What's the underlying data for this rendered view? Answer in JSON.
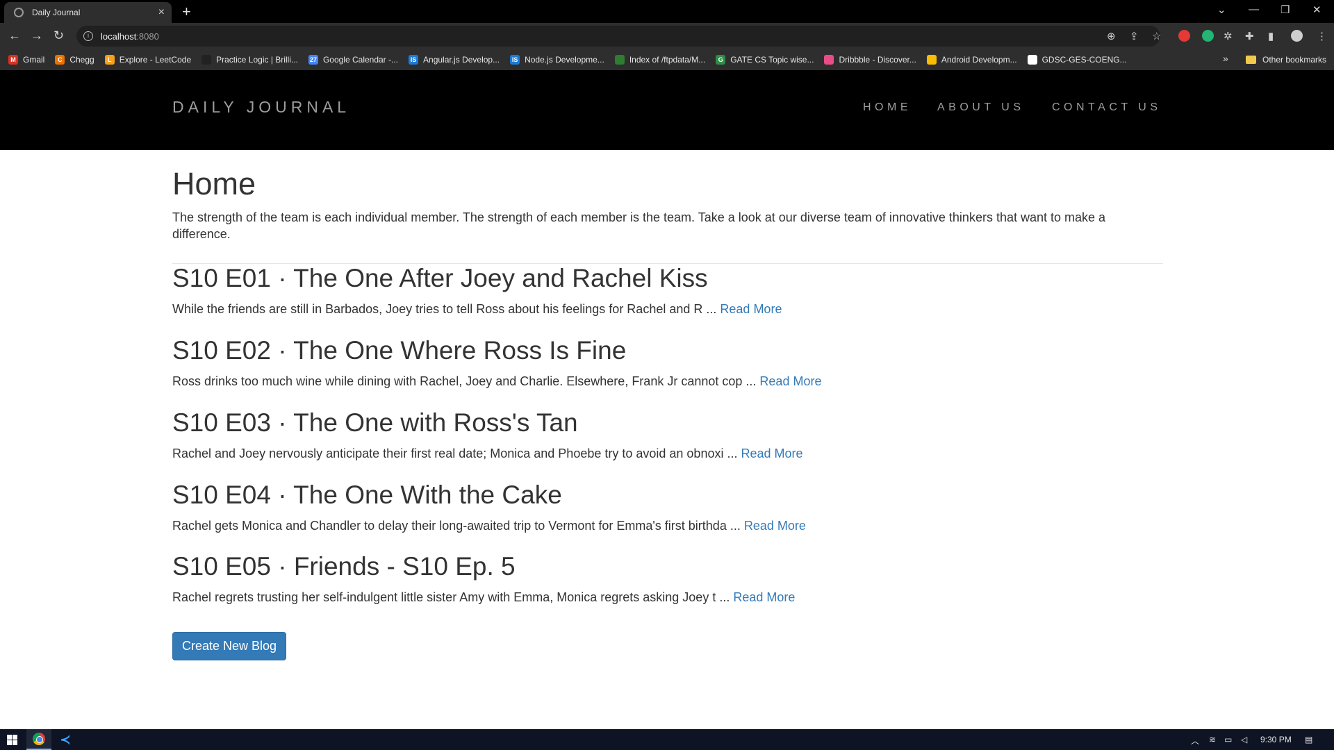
{
  "browser": {
    "tab_title": "Daily Journal",
    "tab_close": "×",
    "new_tab": "+",
    "url_host": "localhost",
    "url_port": ":8080",
    "bookmarks": [
      {
        "label": "Gmail",
        "icon": "gmail-icon",
        "color": "#d93025",
        "glyph": "M"
      },
      {
        "label": "Chegg",
        "icon": "chegg-icon",
        "color": "#eb7100",
        "glyph": "C"
      },
      {
        "label": "Explore - LeetCode",
        "icon": "leetcode-icon",
        "color": "#f89f1b",
        "glyph": "L"
      },
      {
        "label": "Practice Logic | Brilli...",
        "icon": "brilliant-icon",
        "color": "#222222",
        "glyph": ""
      },
      {
        "label": "Google Calendar -...",
        "icon": "calendar-icon",
        "color": "#4285f4",
        "glyph": "27"
      },
      {
        "label": "Angular.js Develop...",
        "icon": "angular-site-icon",
        "color": "#1b7bd6",
        "glyph": "IS"
      },
      {
        "label": "Node.js Developme...",
        "icon": "node-site-icon",
        "color": "#1b7bd6",
        "glyph": "IS"
      },
      {
        "label": "Index of /ftpdata/M...",
        "icon": "globe-icon",
        "color": "#2e7d32",
        "glyph": ""
      },
      {
        "label": "GATE CS Topic wise...",
        "icon": "geeksforgeeks-icon",
        "color": "#2f8d46",
        "glyph": "G"
      },
      {
        "label": "Dribbble - Discover...",
        "icon": "dribbble-icon",
        "color": "#ea4c89",
        "glyph": ""
      },
      {
        "label": "Android Developm...",
        "icon": "drive-icon",
        "color": "#fbbc04",
        "glyph": ""
      },
      {
        "label": "GDSC-GES-COENG...",
        "icon": "github-icon",
        "color": "#ffffff",
        "glyph": ""
      }
    ],
    "more_bookmarks": "»",
    "other_bookmarks": "Other bookmarks"
  },
  "site": {
    "brand": "DAILY JOURNAL",
    "nav": [
      "HOME",
      "ABOUT US",
      "CONTACT US"
    ],
    "page_title": "Home",
    "intro": "The strength of the team is each individual member. The strength of each member is the team. Take a look at our diverse team of innovative thinkers that want to make a difference.",
    "posts": [
      {
        "title": "S10 E01 · The One After Joey and Rachel Kiss",
        "excerpt": "While the friends are still in Barbados, Joey tries to tell Ross about his feelings for Rachel and R ...",
        "link": "Read More"
      },
      {
        "title": "S10 E02 · The One Where Ross Is Fine",
        "excerpt": "Ross drinks too much wine while dining with Rachel, Joey and Charlie. Elsewhere, Frank Jr cannot cop ...",
        "link": "Read More"
      },
      {
        "title": "S10 E03 · The One with Ross's Tan",
        "excerpt": "Rachel and Joey nervously anticipate their first real date; Monica and Phoebe try to avoid an obnoxi ...",
        "link": "Read More"
      },
      {
        "title": "S10 E04 · The One With the Cake",
        "excerpt": "Rachel gets Monica and Chandler to delay their long-awaited trip to Vermont for Emma's first birthda ...",
        "link": "Read More"
      },
      {
        "title": "S10 E05 · Friends - S10 Ep. 5",
        "excerpt": "Rachel regrets trusting her self-indulgent little sister Amy with Emma, Monica regrets asking Joey t ...",
        "link": "Read More"
      }
    ],
    "create_button": "Create New Blog"
  },
  "taskbar": {
    "time": "9:30 PM"
  },
  "colors": {
    "link": "#337ab7",
    "header_bg": "#000000",
    "nav_text": "#9d9d9d"
  }
}
